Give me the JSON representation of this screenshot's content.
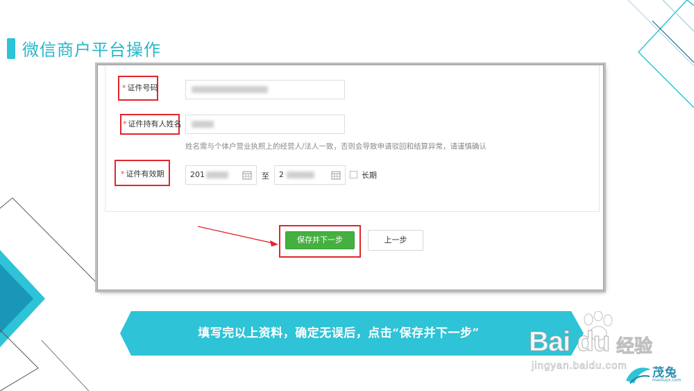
{
  "slide": {
    "title": "微信商户平台操作",
    "banner_text": "填写完以上资料，确定无误后，点击“保存并下一步”",
    "accent_color": "#2ec3d6"
  },
  "form": {
    "id_number": {
      "required_mark": "*",
      "label": "证件号码"
    },
    "holder_name": {
      "required_mark": "*",
      "label": "证件持有人姓名",
      "hint": "姓名需与个体户营业执照上的经营人/法人一致，否则会导致申请驳回和结算异常，请谨慎确认"
    },
    "validity": {
      "required_mark": "*",
      "label": "证件有效期",
      "start_value": "201",
      "end_value": "2",
      "separator": "至",
      "long_term_label": "长期",
      "long_term_checked": false
    },
    "buttons": {
      "save_next": "保存并下一步",
      "prev": "上一步"
    },
    "highlight_color": "#e2242b",
    "primary_button_color": "#45b040"
  },
  "watermark": {
    "brand": "Bai du",
    "brand_cn": "经验",
    "url": "jingyan.baidu.com",
    "logo2": "茂兔",
    "logo2_sub": "maotuyx.com"
  }
}
